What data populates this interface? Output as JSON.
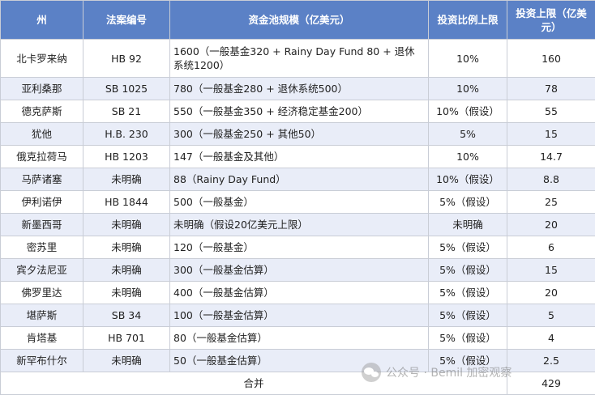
{
  "table": {
    "headers": [
      "州",
      "法案编号",
      "资金池规模（亿美元）",
      "投资比例上限",
      "投资上限（亿美元）"
    ],
    "rows": [
      {
        "state": "北卡罗来纳",
        "bill": "HB 92",
        "pool": "1600（一般基金320 + Rainy Day Fund 80 + 退休系统1200）",
        "ratio": "10%",
        "cap": "160"
      },
      {
        "state": "亚利桑那",
        "bill": "SB 1025",
        "pool": "780（一般基金280 + 退休系统500）",
        "ratio": "10%",
        "cap": "78"
      },
      {
        "state": "德克萨斯",
        "bill": "SB 21",
        "pool": "550（一般基金350 + 经济稳定基金200）",
        "ratio": "10%（假设）",
        "cap": "55"
      },
      {
        "state": "犹他",
        "bill": "H.B. 230",
        "pool": "300（一般基金250 + 其他50）",
        "ratio": "5%",
        "cap": "15"
      },
      {
        "state": "俄克拉荷马",
        "bill": "HB 1203",
        "pool": "147（一般基金及其他）",
        "ratio": "10%",
        "cap": "14.7"
      },
      {
        "state": "马萨诸塞",
        "bill": "未明确",
        "pool": "88（Rainy Day Fund）",
        "ratio": "10%（假设）",
        "cap": "8.8"
      },
      {
        "state": "伊利诺伊",
        "bill": "HB 1844",
        "pool": "500（一般基金）",
        "ratio": "5%（假设）",
        "cap": "25"
      },
      {
        "state": "新墨西哥",
        "bill": "未明确",
        "pool": "未明确（假设20亿美元上限）",
        "ratio": "未明确",
        "cap": "20"
      },
      {
        "state": "密苏里",
        "bill": "未明确",
        "pool": "120（一般基金）",
        "ratio": "5%（假设）",
        "cap": "6"
      },
      {
        "state": "宾夕法尼亚",
        "bill": "未明确",
        "pool": "300（一般基金估算）",
        "ratio": "5%（假设）",
        "cap": "15"
      },
      {
        "state": "佛罗里达",
        "bill": "未明确",
        "pool": "400（一般基金估算）",
        "ratio": "5%（假设）",
        "cap": "20"
      },
      {
        "state": "堪萨斯",
        "bill": "SB 34",
        "pool": "100（一般基金估算）",
        "ratio": "5%（假设）",
        "cap": "5"
      },
      {
        "state": "肯塔基",
        "bill": "HB 701",
        "pool": "80（一般基金估算）",
        "ratio": "5%（假设）",
        "cap": "4"
      },
      {
        "state": "新罕布什尔",
        "bill": "未明确",
        "pool": "50（一般基金估算）",
        "ratio": "5%（假设）",
        "cap": "2.5"
      }
    ],
    "total": {
      "label": "合并",
      "cap": "429"
    }
  },
  "watermark": {
    "text": "公众号 · Bemil 加密观察"
  },
  "colors": {
    "header_bg": "#5b81c6",
    "header_text": "#ffffff",
    "alt_row_bg": "#e9edf8",
    "border": "#c9cdd6"
  }
}
